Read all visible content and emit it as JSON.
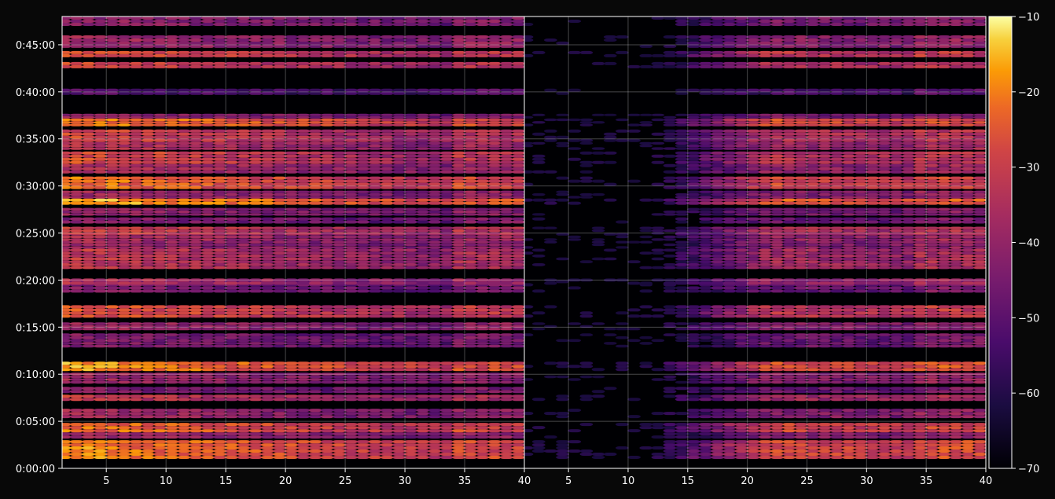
{
  "chart_data": {
    "type": "heatmap",
    "title": "",
    "xlabel": "",
    "ylabel": "",
    "colormap": "inferno",
    "background": "#080808",
    "grid": true,
    "panels": [
      {
        "name": "",
        "xlim": [
          1.3,
          40
        ],
        "x_ticks": [
          5,
          10,
          15,
          20,
          25,
          30,
          35,
          40
        ],
        "x_tick_labels": [
          "5",
          "10",
          "15",
          "20",
          "25",
          "30",
          "35",
          "40"
        ]
      },
      {
        "name": "",
        "xlim": [
          1.3,
          40
        ],
        "x_ticks": [
          5,
          10,
          15,
          20,
          25,
          30,
          35,
          40
        ],
        "x_tick_labels": [
          "5",
          "10",
          "15",
          "20",
          "25",
          "30",
          "35",
          "40"
        ]
      }
    ],
    "ylim_seconds": [
      0,
      2880
    ],
    "y_ticks_seconds": [
      0,
      300,
      600,
      900,
      1200,
      1500,
      1800,
      2100,
      2400,
      2700
    ],
    "y_tick_labels": [
      "0:00:00",
      "0:05:00",
      "0:10:00",
      "0:15:00",
      "0:20:00",
      "0:25:00",
      "0:30:00",
      "0:35:00",
      "0:40:00",
      "0:45:00"
    ],
    "colorbar": {
      "range": [
        -70,
        -10
      ],
      "ticks": [
        -10,
        -20,
        -30,
        -40,
        -50,
        -60,
        -70
      ],
      "tick_labels": [
        "−10",
        "−20",
        "−30",
        "−40",
        "−50",
        "−60",
        "−70"
      ]
    },
    "bands": [
      {
        "t0": 60,
        "t1": 180,
        "strength": 0.85
      },
      {
        "t0": 190,
        "t1": 230,
        "strength": 0.55
      },
      {
        "t0": 230,
        "t1": 290,
        "strength": 0.82
      },
      {
        "t0": 320,
        "t1": 380,
        "strength": 0.55
      },
      {
        "t0": 430,
        "t1": 470,
        "strength": 0.65
      },
      {
        "t0": 480,
        "t1": 520,
        "strength": 0.45
      },
      {
        "t0": 540,
        "t1": 610,
        "strength": 0.55
      },
      {
        "t0": 620,
        "t1": 680,
        "strength": 0.88
      },
      {
        "t0": 770,
        "t1": 860,
        "strength": 0.45
      },
      {
        "t0": 880,
        "t1": 930,
        "strength": 0.55
      },
      {
        "t0": 960,
        "t1": 1040,
        "strength": 0.75
      },
      {
        "t0": 1120,
        "t1": 1200,
        "strength": 0.45
      },
      {
        "t0": 1170,
        "t1": 1210,
        "strength": 0.6
      },
      {
        "t0": 1270,
        "t1": 1400,
        "strength": 0.65
      },
      {
        "t0": 1400,
        "t1": 1450,
        "strength": 0.55
      },
      {
        "t0": 1450,
        "t1": 1500,
        "strength": 0.6
      },
      {
        "t0": 1490,
        "t1": 1540,
        "strength": 0.7
      },
      {
        "t0": 1560,
        "t1": 1600,
        "strength": 0.45
      },
      {
        "t0": 1610,
        "t1": 1660,
        "strength": 0.5
      },
      {
        "t0": 1680,
        "t1": 1720,
        "strength": 0.92
      },
      {
        "t0": 1720,
        "t1": 1770,
        "strength": 0.55
      },
      {
        "t0": 1780,
        "t1": 1860,
        "strength": 0.82
      },
      {
        "t0": 1880,
        "t1": 1940,
        "strength": 0.6
      },
      {
        "t0": 1940,
        "t1": 2020,
        "strength": 0.72
      },
      {
        "t0": 2030,
        "t1": 2080,
        "strength": 0.62
      },
      {
        "t0": 2080,
        "t1": 2160,
        "strength": 0.7
      },
      {
        "t0": 2180,
        "t1": 2230,
        "strength": 0.85
      },
      {
        "t0": 2230,
        "t1": 2260,
        "strength": 0.5
      },
      {
        "t0": 2380,
        "t1": 2420,
        "strength": 0.3
      },
      {
        "t0": 2550,
        "t1": 2590,
        "strength": 0.7
      },
      {
        "t0": 2620,
        "t1": 2660,
        "strength": 0.75
      },
      {
        "t0": 2680,
        "t1": 2720,
        "strength": 0.55
      },
      {
        "t0": 2720,
        "t1": 2760,
        "strength": 0.55
      },
      {
        "t0": 2820,
        "t1": 2880,
        "strength": 0.5
      }
    ]
  }
}
